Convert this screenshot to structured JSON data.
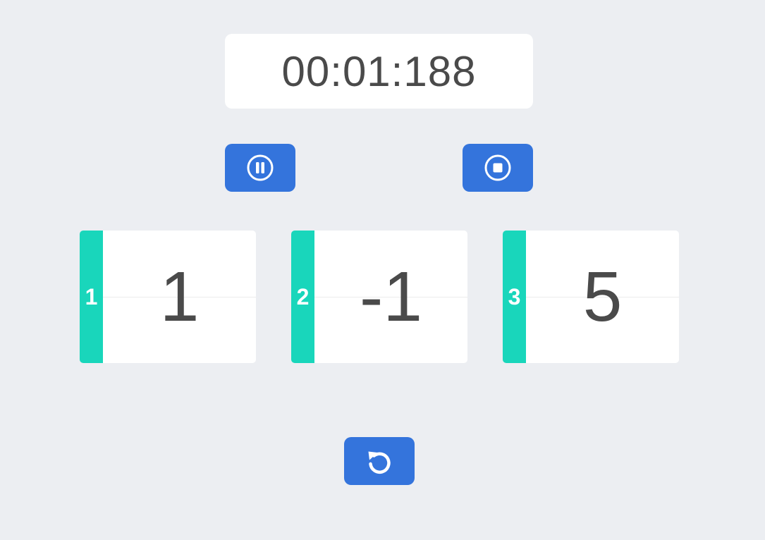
{
  "timer": {
    "display": "00:01:188"
  },
  "controls": {
    "pause": {
      "icon": "pause-circle-icon"
    },
    "stop": {
      "icon": "stop-circle-icon"
    },
    "reset": {
      "icon": "reset-icon"
    }
  },
  "counters": [
    {
      "index": "1",
      "value": "1"
    },
    {
      "index": "2",
      "value": "-1"
    },
    {
      "index": "3",
      "value": "5"
    }
  ],
  "colors": {
    "background": "#eceef2",
    "button": "#3474dc",
    "tab": "#19d6bb",
    "text": "#4a4a4a",
    "card": "#ffffff"
  }
}
